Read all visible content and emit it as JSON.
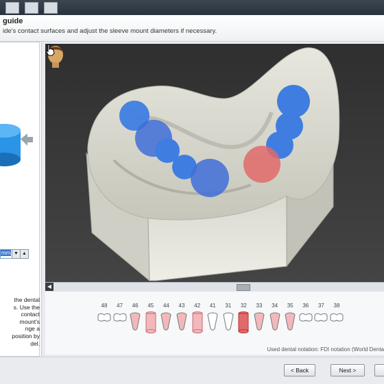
{
  "header": {
    "title": "guide",
    "instruction": "ide's contact surfaces and adjust the sleeve mount diameters if necessary."
  },
  "left_panel": {
    "diameter_value": "mm",
    "help_lines": [
      "the dental",
      "s. Use the",
      "contact",
      "mount's",
      "nge a",
      "position by",
      "del."
    ]
  },
  "tooth_chart": {
    "numbers": [
      "48",
      "47",
      "46",
      "45",
      "44",
      "43",
      "42",
      "41",
      "31",
      "32",
      "33",
      "34",
      "35",
      "36",
      "37",
      "38"
    ],
    "states": [
      "molar",
      "molar",
      "pink",
      "sleeve",
      "pink",
      "pink",
      "sleeve",
      "white",
      "white",
      "sleeve-red",
      "pink",
      "pink",
      "pink",
      "molar",
      "molar",
      "molar"
    ],
    "notation": "Used dental notation: FDI notation (World Denta"
  },
  "footer": {
    "back_label": "< Back",
    "next_label": "Next >"
  },
  "colors": {
    "sleeve_blue": "#3f7ee0",
    "sleeve_red": "#e06a6a",
    "cylinder_blue": "#1f8fe0",
    "pink_tooth": "#f2b8bb"
  }
}
